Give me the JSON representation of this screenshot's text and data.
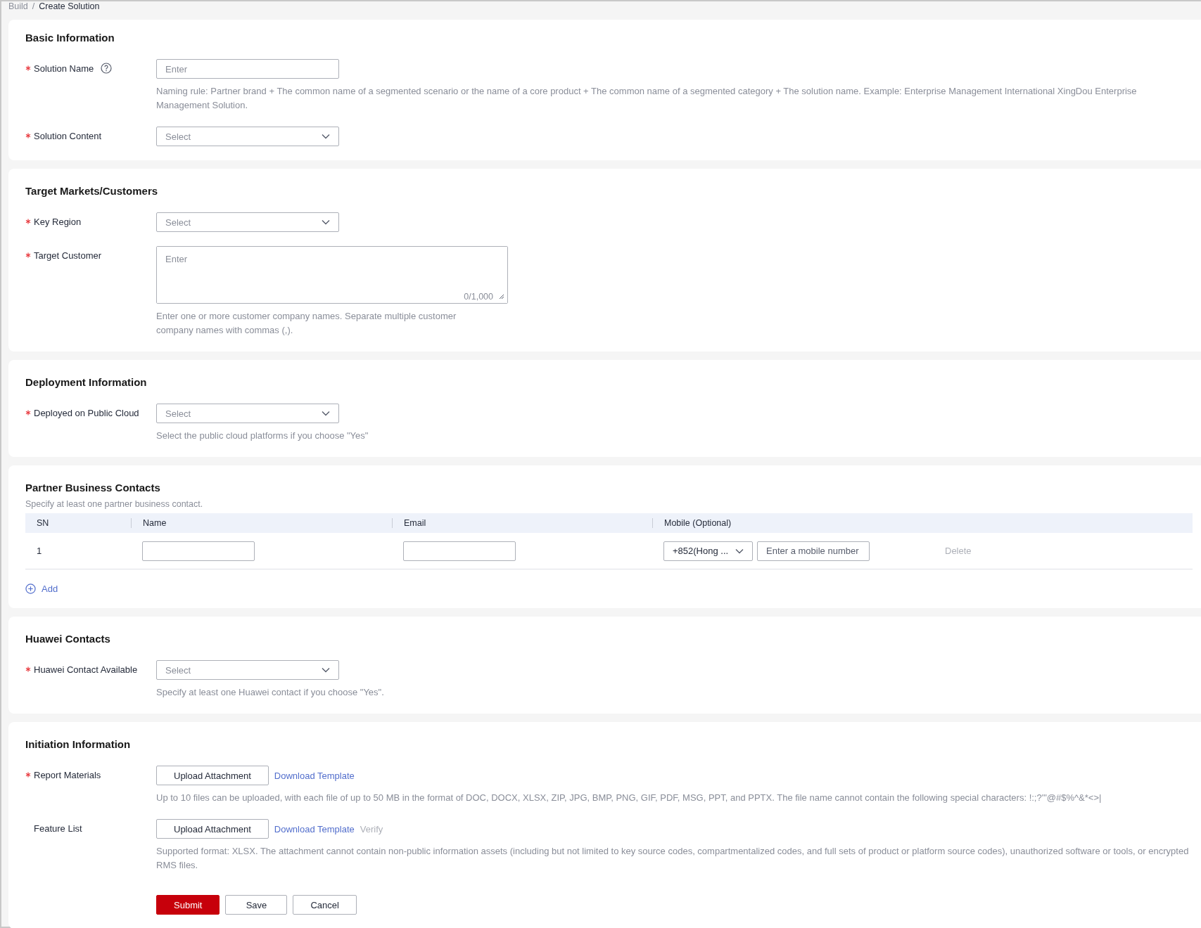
{
  "breadcrumb": [
    {
      "label": "Build",
      "selected": false
    },
    {
      "label": "Create Solution",
      "selected": true
    }
  ],
  "breadcrumb_separator": "/",
  "sections": [
    {
      "kind": "form",
      "title": "Basic Information",
      "fields": [
        {
          "kind": "input",
          "label": "Solution Name",
          "required": true,
          "help": true,
          "placeholder": "Enter",
          "hint": "Naming rule: Partner brand + The common name of a segmented scenario or the name of a core product + The common name of a segmented category + The solution name. Example: Enterprise Management International XingDou Enterprise Management Solution."
        },
        {
          "kind": "select",
          "label": "Solution Content",
          "required": true,
          "placeholder": "Select"
        }
      ]
    },
    {
      "kind": "form",
      "title": "Target Markets/Customers",
      "fields": [
        {
          "kind": "select",
          "label": "Key Region",
          "required": true,
          "placeholder": "Select"
        },
        {
          "kind": "textarea",
          "label": "Target Customer",
          "required": true,
          "placeholder": "Enter",
          "counter": "0/1,000",
          "hint": "Enter one or more customer company names. Separate multiple customer company names with commas (,)."
        }
      ]
    },
    {
      "kind": "form",
      "title": "Deployment Information",
      "fields": [
        {
          "kind": "select",
          "label": "Deployed on Public Cloud",
          "required": true,
          "placeholder": "Select",
          "hint": "Select the public cloud platforms if you choose \"Yes\""
        }
      ]
    },
    {
      "kind": "contacts",
      "title": "Partner Business Contacts",
      "subtitle": "Specify at least one partner business contact.",
      "columns": [
        "SN",
        "Name",
        "Email",
        "Mobile (Optional)"
      ],
      "rows": [
        {
          "sn": "1",
          "country_code": "+852(Hong ...",
          "mobile_placeholder": "Enter a mobile number",
          "delete": "Delete",
          "delete_disabled": true
        }
      ],
      "add": "Add"
    },
    {
      "kind": "form",
      "title": "Huawei Contacts",
      "fields": [
        {
          "kind": "select",
          "label": "Huawei Contact Available",
          "required": true,
          "placeholder": "Select",
          "hint": "Specify at least one Huawei contact if you choose \"Yes\"."
        }
      ]
    },
    {
      "kind": "form",
      "title": "Initiation Information",
      "fields": [
        {
          "kind": "upload",
          "label": "Report Materials",
          "required": true,
          "button": "Upload Attachment",
          "link": "Download Template",
          "hint": "Up to 10 files can be uploaded, with each file of up to 50 MB in the format of DOC, DOCX, XLSX, ZIP, JPG, BMP, PNG, GIF, PDF, MSG, PPT, and PPTX. The file name cannot contain the following special characters: !:;?'\"@#$%^&*<>|"
        },
        {
          "kind": "upload",
          "label": "Feature List",
          "required": false,
          "button": "Upload Attachment",
          "link": "Download Template",
          "verify": "Verify",
          "verify_disabled": true,
          "hint": "Supported format: XLSX. The attachment cannot contain non-public information assets (including but not limited to key source codes, compartmentalized codes, and full sets of product or platform source codes), unauthorized software or tools, or encrypted RMS files."
        }
      ],
      "actions": [
        {
          "label": "Submit",
          "kind": "primary"
        },
        {
          "label": "Save",
          "kind": "default"
        },
        {
          "label": "Cancel",
          "kind": "default"
        }
      ]
    }
  ]
}
